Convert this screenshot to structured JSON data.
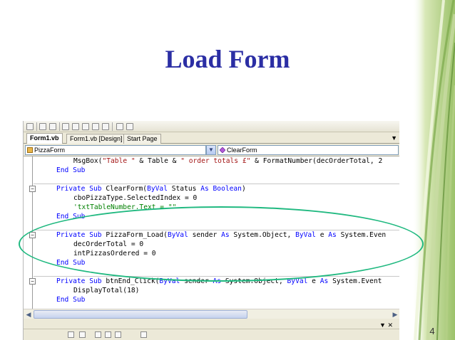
{
  "slide": {
    "title": "Load Form",
    "page_number": "4"
  },
  "ide": {
    "tabs": [
      {
        "label": "Form1.vb",
        "active": true
      },
      {
        "label": "Form1.vb [Design]",
        "active": false
      },
      {
        "label": "Start Page",
        "active": false
      }
    ],
    "object_combo": "PizzaForm",
    "method_combo": "ClearForm",
    "code_lines": [
      {
        "indent": 2,
        "parts": [
          [
            "plain",
            "MsgBox("
          ],
          [
            "str",
            "\"Table \""
          ],
          [
            "plain",
            " & Table & "
          ],
          [
            "str",
            "\" order totals £\""
          ],
          [
            "plain",
            " & FormatNumber(decOrderTotal, 2"
          ]
        ]
      },
      {
        "indent": 1,
        "parts": [
          [
            "kw",
            "End Sub"
          ]
        ]
      },
      {
        "indent": 0,
        "parts": [
          [
            "plain",
            ""
          ]
        ]
      },
      {
        "indent": 1,
        "fold": true,
        "parts": [
          [
            "kw",
            "Private Sub"
          ],
          [
            "plain",
            " ClearForm("
          ],
          [
            "kw",
            "ByVal"
          ],
          [
            "plain",
            " Status "
          ],
          [
            "kw",
            "As Boolean"
          ],
          [
            "plain",
            ")"
          ]
        ]
      },
      {
        "indent": 2,
        "parts": [
          [
            "plain",
            "cboPizzaType.SelectedIndex = 0"
          ]
        ]
      },
      {
        "indent": 2,
        "parts": [
          [
            "cmt",
            "'txtTableNumber.Text = \"\""
          ]
        ]
      },
      {
        "indent": 1,
        "parts": [
          [
            "kw",
            "End Sub"
          ]
        ]
      },
      {
        "indent": 0,
        "parts": [
          [
            "plain",
            ""
          ]
        ]
      },
      {
        "indent": 1,
        "fold": true,
        "parts": [
          [
            "kw",
            "Private Sub"
          ],
          [
            "plain",
            " PizzaForm_Load("
          ],
          [
            "kw",
            "ByVal"
          ],
          [
            "plain",
            " sender "
          ],
          [
            "kw",
            "As"
          ],
          [
            "plain",
            " System.Object, "
          ],
          [
            "kw",
            "ByVal"
          ],
          [
            "plain",
            " e "
          ],
          [
            "kw",
            "As"
          ],
          [
            "plain",
            " System.Even"
          ]
        ]
      },
      {
        "indent": 2,
        "parts": [
          [
            "plain",
            "decOrderTotal = 0"
          ]
        ]
      },
      {
        "indent": 2,
        "parts": [
          [
            "plain",
            "intPizzasOrdered = 0"
          ]
        ]
      },
      {
        "indent": 1,
        "parts": [
          [
            "kw",
            "End Sub"
          ]
        ]
      },
      {
        "indent": 0,
        "parts": [
          [
            "plain",
            ""
          ]
        ]
      },
      {
        "indent": 1,
        "fold": true,
        "parts": [
          [
            "kw",
            "Private Sub"
          ],
          [
            "plain",
            " btnEnd_Click("
          ],
          [
            "kw",
            "ByVal"
          ],
          [
            "plain",
            " sender "
          ],
          [
            "kw",
            "As"
          ],
          [
            "plain",
            " System.Object, "
          ],
          [
            "kw",
            "ByVal"
          ],
          [
            "plain",
            " e "
          ],
          [
            "kw",
            "As"
          ],
          [
            "plain",
            " System.Event"
          ]
        ]
      },
      {
        "indent": 2,
        "parts": [
          [
            "plain",
            "DisplayTotal(18)"
          ]
        ]
      },
      {
        "indent": 1,
        "parts": [
          [
            "kw",
            "End Sub"
          ]
        ]
      }
    ]
  },
  "colors": {
    "title": "#2b2ea4",
    "keyword": "#0000ff",
    "string": "#a31515",
    "comment": "#008000",
    "highlight_ellipse": "#20b980"
  },
  "icons": {
    "toolbar": [
      "comment-icon",
      "uncomment-icon",
      "indent-icon",
      "outdent-icon",
      "bookmark-icon",
      "prev-bookmark-icon",
      "next-bookmark-icon",
      "clear-bookmark-icon"
    ],
    "object_combo_icon": "class-icon",
    "method_combo_icon": "method-icon",
    "tab_dropdown": "chevron-down-icon",
    "scroll_left": "chevron-left-icon",
    "scroll_right": "chevron-right-icon"
  }
}
